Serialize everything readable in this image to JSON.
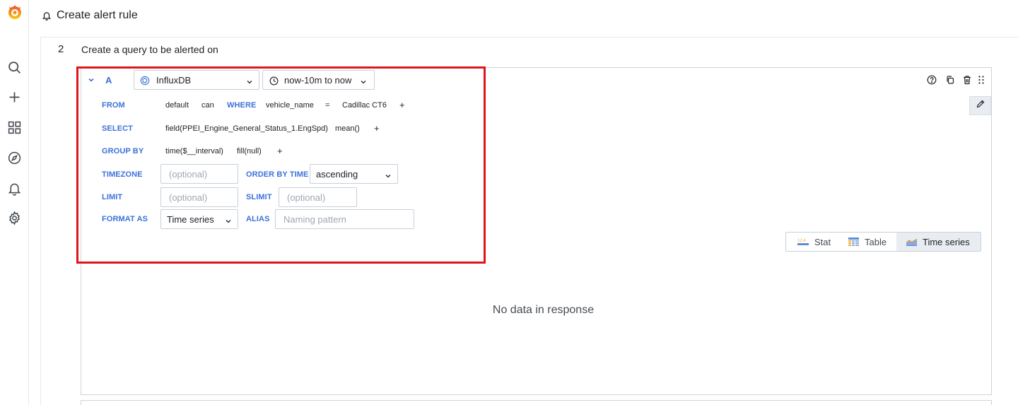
{
  "header": {
    "title": "Create alert rule"
  },
  "sidebar": {
    "items": [
      {
        "icon": "search-icon"
      },
      {
        "icon": "plus-icon"
      },
      {
        "icon": "dashboards-icon"
      },
      {
        "icon": "explore-compass-icon"
      },
      {
        "icon": "alerting-bell-icon"
      },
      {
        "icon": "settings-gear-icon"
      }
    ]
  },
  "step": {
    "number": "2",
    "title": "Create a query to be alerted on"
  },
  "query": {
    "letter": "A",
    "datasource": "InfluxDB",
    "time_range": "now-10m to now",
    "from": {
      "keyword": "FROM",
      "policy": "default",
      "measurement": "can",
      "where_keyword": "WHERE",
      "tag_key": "vehicle_name",
      "operator": "=",
      "tag_value": "Cadillac CT6",
      "plus": "+"
    },
    "select": {
      "keyword": "SELECT",
      "field": "field(PPEI_Engine_General_Status_1.EngSpd)",
      "aggregation": "mean()",
      "plus": "+"
    },
    "group_by": {
      "keyword": "GROUP BY",
      "time": "time($__interval)",
      "fill": "fill(null)",
      "plus": "+"
    },
    "timezone": {
      "keyword": "TIMEZONE",
      "placeholder": "(optional)"
    },
    "order_by_time": {
      "keyword": "ORDER BY TIME",
      "value": "ascending"
    },
    "limit": {
      "keyword": "LIMIT",
      "placeholder": "(optional)"
    },
    "slimit": {
      "keyword": "SLIMIT",
      "placeholder": "(optional)"
    },
    "format_as": {
      "keyword": "FORMAT AS",
      "value": "Time series"
    },
    "alias": {
      "keyword": "ALIAS",
      "placeholder": "Naming pattern"
    }
  },
  "viz_switch": {
    "options": [
      {
        "label": "Stat",
        "icon": "stat-icon",
        "active": false
      },
      {
        "label": "Table",
        "icon": "table-icon",
        "active": false
      },
      {
        "label": "Time series",
        "icon": "time-series-icon",
        "active": true
      }
    ]
  },
  "preview": {
    "message": "No data in response"
  },
  "colors": {
    "keyword_blue": "#3d71d9",
    "highlight_red": "#e0151c",
    "logo_orange": "#f46800"
  }
}
